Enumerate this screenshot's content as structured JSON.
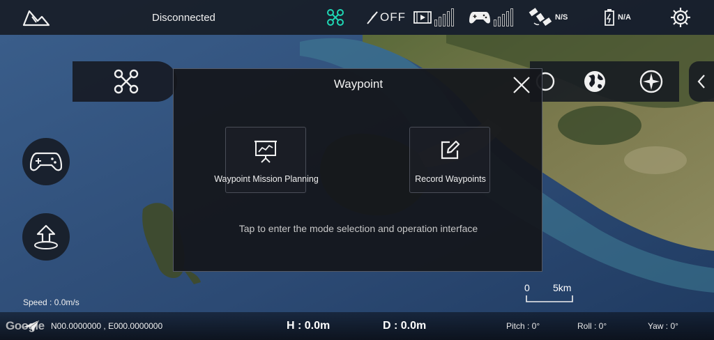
{
  "topbar": {
    "connection_status": "Disconnected",
    "motor_status": "OFF",
    "gps_status": "N/S",
    "battery_status": "N/A"
  },
  "icons": {
    "home": "map-home-icon",
    "aircraft": "drone-icon",
    "motor": "propeller-off-icon",
    "video": "video-signal-icon",
    "controller": "gamepad-icon",
    "gps": "satellite-icon",
    "battery": "battery-icon",
    "settings": "gear-icon"
  },
  "dialog": {
    "title": "Waypoint",
    "options": [
      {
        "label": "Waypoint Mission Planning",
        "icon": "presentation-chart-icon"
      },
      {
        "label": "Record Waypoints",
        "icon": "edit-icon"
      }
    ],
    "hint": "Tap to enter the mode selection and operation interface"
  },
  "scale_bar": {
    "zero": "0",
    "distance": "5km"
  },
  "telemetry": {
    "speed": "Speed :  0.0m/s",
    "coordinates": "N00.0000000 , E000.0000000",
    "height": "H :  0.0m",
    "distance": "D :  0.0m",
    "pitch": "Pitch :  0°",
    "roll": "Roll :  0°",
    "yaw": "Yaw :  0°"
  },
  "map_attribution": "Google",
  "colors": {
    "accent": "#1fd6b4",
    "panel": "#161a22",
    "sea": "#2d4a73"
  }
}
